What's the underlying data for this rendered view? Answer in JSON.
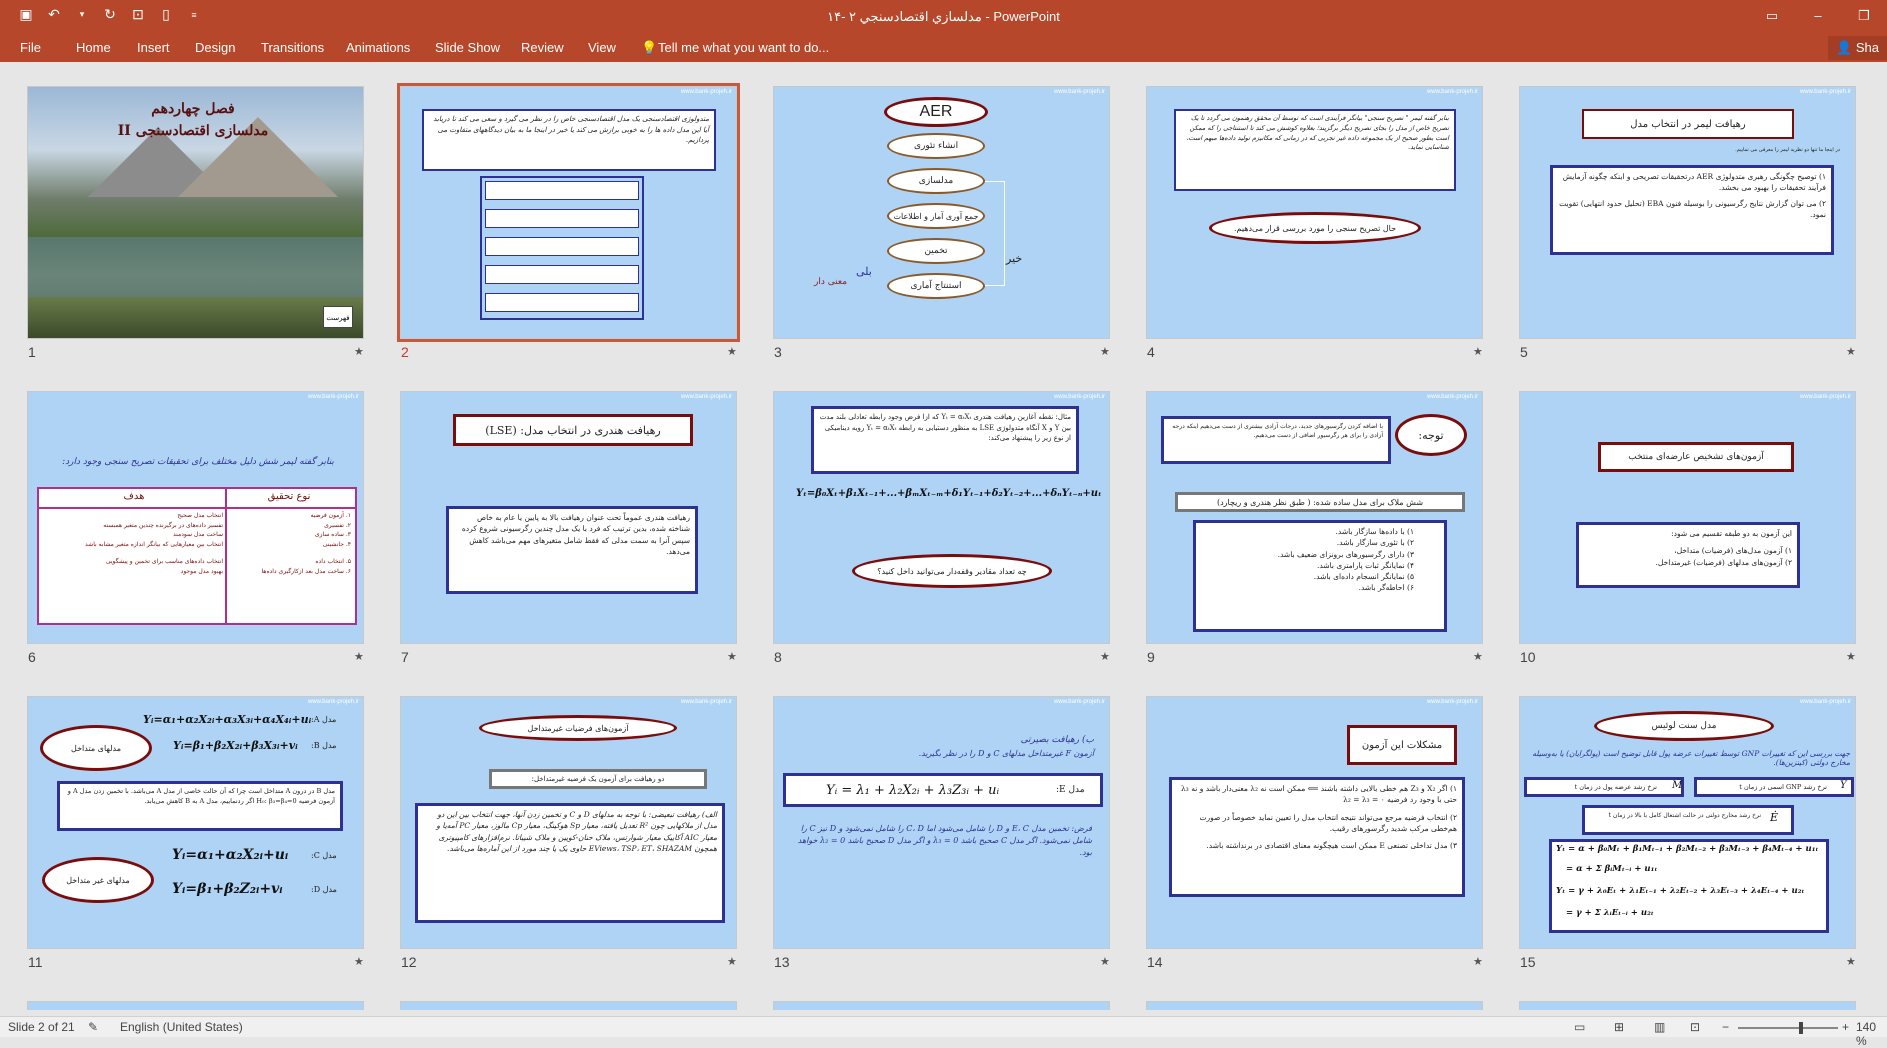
{
  "window": {
    "title": "۱۴- مدلسازي اقتصادسنجي ۲ - PowerPoint",
    "share": "Sha"
  },
  "qat_icons": [
    "save-icon",
    "undo-icon",
    "dropdown-icon",
    "redo-icon",
    "present-icon",
    "new-icon",
    "customize-icon"
  ],
  "ribbon": {
    "tabs": [
      "File",
      "Home",
      "Insert",
      "Design",
      "Transitions",
      "Animations",
      "Slide Show",
      "Review",
      "View"
    ],
    "tell_me": "Tell me what you want to do..."
  },
  "watermark": "www.bank-projeh.ir",
  "slides": {
    "s1": {
      "num": "1",
      "title": "فصل چهاردهم",
      "subtitle": "مدلسازی اقتصادسنجی II",
      "badge": "فهرست"
    },
    "s2": {
      "num": "2",
      "text": "متدولوژی اقتصادسنجی یک مدل اقتصادسنجی خاص را در نظر می گیرد و سعی می کند تا دریابد آیا این مدل داده ها را به خوبی برازش می کند یا خیر در اینجا ما به بیان دیدگاههای متفاوت می پردازیم."
    },
    "s3": {
      "num": "3",
      "aer": "AER",
      "steps": [
        "انشاء تئوری",
        "مدلسازی",
        "جمع آوری آمار و اطلاعات",
        "تخمین",
        "استنتاج آماری"
      ],
      "yes": "بلی",
      "no": "خیر",
      "meaningful": "معنی دار"
    },
    "s4": {
      "num": "4",
      "text": "بنابر گفته لیمر \" تصریح سنجی\" بیانگر فرآیندی است که توسط آن محقق رهنمون می گردد تا یک تصریح خاص از مدل را بجای تصریح دیگر برگزیند؛ بعلاوه کوشش می کند تا استنتاجی را که ممکن است بطور صحیح از یک مجموعه داده غیر تجربی که در زمانی که مکانیزم تولید داده‌ها مبهم است، شناسایی نماید.",
      "oval": "حال تصریح سنجی را مورد بررسی قرار می‌دهیم."
    },
    "s5": {
      "num": "5",
      "title": "رهیافت لیمر در انتخاب مدل",
      "note": "در اینجا ما تنها دو نظریه لیمر را معرفی می نماییم.",
      "p1": "۱) توصیح چگونگی رهبری متدولوژی AER درتحقیقات تصریحی و اینکه چگونه آزمایش فرآیند تحقیقات را بهبود می بخشد.",
      "p2": "۲) می توان گزارش نتایج رگرسیونی را بوسیله فنون EBA (تحلیل حدود انتهایی) تقویت نمود."
    },
    "s6": {
      "num": "6",
      "intro": "بنابر گفته لیمر شش دلیل مختلف برای تحقیقات تصریح سنجی وجود دارد:",
      "col1": "نوع تحقیق",
      "col2": "هدف",
      "rows1": [
        "۱. آزمون فرضیه",
        "۲. تفسیری",
        "۳. ساده سازی",
        "۴. جانشینی",
        "۵. انتخاب داده",
        "۶. ساخت مدل بعد ازکارگیری داده‌ها"
      ],
      "rows2": [
        "انتخاب مدل صحیح",
        "تفسیر داده‌های در برگیرنده چندین متغیر همبسته",
        "ساخت مدل سودمند",
        "انتخاب بین معیارهایی که بیانگر اندازه متغیر مشابه باشد",
        "انتخاب داده‌های مناسب برای تخمین و پیشگویی",
        "بهبود مدل موجود"
      ]
    },
    "s7": {
      "num": "7",
      "title": "رهیافت هندری در انتخاب مدل: (LSE)",
      "text": "رهیافت هندری عموماً تحت عنوان رهیافت بالا به پایین یا عام به خاص شناخته شده، بدین ترتیب که فرد با یک مدل چندین رگرسیونی شروع کرده سپس آنرا به سمت مدلی که فقط شامل متغیرهای مهم می‌باشد کاهش می‌دهد."
    },
    "s8": {
      "num": "8",
      "text": "مثال: نقطه آغازین رهیافت هندری Yₜ = αₜXₜ که ازا فرض وجود رابطه تعادلی بلند مدت بین Y و X آنگاه متدولوژی LSE به منظور دستیابی به رابطه Yₜ = αₜXₜ رویه دینامیکی از نوع زیر را پیشنهاد می‌کند:",
      "eq": "Yₜ=β₀Xₜ+β₁Xₜ₋₁+...+βₘXₜ₋ₘ+δ₁Yₜ₋₁+δ₂Yₜ₋₂+...+δₙYₜ₋ₙ+uₜ",
      "oval": "چه تعداد مقادیر وقفه‌دار می‌توانید داخل کنید؟"
    },
    "s9": {
      "num": "9",
      "title": "توجه:",
      "text": "با اضافه کردن رگرسیورهای جدید، درجات آزادی بیشتری از دست می‌دهیم اینکه درجه آزادی را برای هر رگرسیور اضافی از دست می‌دهیم.",
      "heading": "شش ملاک برای مدل ساده شده: ( طبق نظر هندری و ریچارد)",
      "items": [
        "۱) با داده‌ها سازگار باشد.",
        "۲) با تئوری سازگار باشد.",
        "۳) دارای رگرسیورهای برونزای ضعیف باشد.",
        "۴) نمایانگر ثبات پارامتری باشد.",
        "۵) نمایانگر انسجام داده‌ای باشد.",
        "۶) احاطه‌گر باشد."
      ]
    },
    "s10": {
      "num": "10",
      "title": "آزمون‌های تشخیص عارضه‌ای منتخب",
      "intro": "این آزمون به دو طبقه تقسیم می شود:",
      "i1": "۱) آزمون مدل‌های (فرضیات) متداخل،",
      "i2": "۲) آزمون‌های مدلهای (فرضیات) غیرمتداخل."
    },
    "s11": {
      "num": "11",
      "eqA": "Yᵢ=α₁+α₂X₂ᵢ+α₃X₃ᵢ+α₄X₄ᵢ+uᵢ",
      "eqB": "Yᵢ=β₁+β₂X₂ᵢ+β₃X₃ᵢ+vᵢ",
      "labelA": "مدل A:",
      "labelB": "مدل B:",
      "oval1": "مدلهای متداخل",
      "text": "مدل B در درون A متداخل است چرا که آن حالت خاصی از مدل A می‌باشد. با تخمین زدن مدل A و آزمون فرضیه H₀: β₃=β₄=0 اگر ردنماییم، مدل A به B کاهش می‌یابد.",
      "eqC": "Yᵢ=α₁+α₂X₂ᵢ+uᵢ",
      "eqD": "Yᵢ=β₁+β₂Z₂ᵢ+vᵢ",
      "labelC": "مدل C:",
      "labelD": "مدل D:",
      "oval2": "مدلهای غیر متداخل"
    },
    "s12": {
      "num": "12",
      "title": "آزمون‌های فرضیات غیرمتداخل",
      "sub": "دو رهیافت برای آزمون یک فرضیه غیرمتداخل:",
      "text": "الف) رهیافت تبعیضی: با توجه به مدلهای D و C و تخمین زدن آنها، جهت انتخاب بین این دو مدل از ملاکهایی چون R² تعدیل یافته، معیار Sp هوکینگ، معیار Cp مالوز، معیار PC آمه‌یا و معیار AIC آکاییک معیار شوارتس، ملاک حنان-کویین و ملاک شیباتا. نرم‌افزارهای کامپیوتری همچون EViews، TSP، ET، SHAZAM حاوی یک یا چند مورد از این آماره‌ها می‌باشد."
    },
    "s13": {
      "num": "13",
      "title": "ب) رهیافت بصیرتی",
      "sub": "آزمون F غیرمتداخل مدلهای C و D را در نظر بگیرید.",
      "eq": "Yᵢ = λ₁ + λ₂X₂ᵢ + λ₃Z₃ᵢ + uᵢ",
      "label": "مدل E:",
      "text": "فرض: تخمین مدل E، C و D را شامل می‌شود اما C، D را شامل نمی‌شود و D نیز C را شامل نمی‌شود. اگر مدل C صحیح باشد λ₃ = 0 و اگر مدل D صحیح باشد λ₂ = 0 خواهد بود."
    },
    "s14": {
      "num": "14",
      "title": "مشکلات این آزمون",
      "p1": "۱) اگر X₂ و Z₃ هم خطی بالایی داشته باشند ⟸ ممکن است نه λ₂ معنی‌دار باشد و نه λ₃ حتی با وجود رد فرضیه λ₂ = λ₃ = ۰",
      "p2": "۲) انتخاب فرضیه مرجع می‌تواند نتیجه انتخاب مدل را تعیین نماید خصوصاً در صورت هم‌خطی مرکب شدید رگرسورهای رقیب.",
      "p3": "۳) مدل تداخلی تصنعی E ممکن است هیچگونه معنای اقتصادی در برنداشته باشد."
    },
    "s15": {
      "num": "15",
      "title": "مدل سنت لوئیس",
      "text": "جهت بررسی این که تغییرات GNP توسط تغییرات عرضه پول قابل توضیح است (پولگرایان) یا به‌وسیله مخارج دولتی (کینزین‌ها).",
      "l1": "نرخ رشد GNP اسمی در زمان t",
      "l2": "نرخ رشد عرضه پول در زمان t",
      "l3": "نرخ رشد مخارج دولتی در حالت اشتغال کامل یا بالا در زمان t",
      "e1": "Yₜ = α + β₀Mₜ + β₁Mₜ₋₁ + β₂Mₜ₋₂ + β₃Mₜ₋₃ + β₄Mₜ₋₄ + u₁ₜ",
      "e2": "= α + Σ βᵢMₜ₋ᵢ + u₁ₜ",
      "e3": "Yₜ = γ + λ₀Eₜ + λ₁Eₜ₋₁ + λ₂Eₜ₋₂ + λ₃Eₜ₋₃ + λ₄Eₜ₋₄ + u₂ₜ",
      "e4": "= γ + Σ λᵢEₜ₋ᵢ + u₂ₜ",
      "sym1": "Ẏ",
      "sym2": "Ṁ",
      "sym3": "Ė"
    }
  },
  "status": {
    "slide": "Slide 2 of 21",
    "lang": "English (United States)",
    "zoom": "140 %"
  }
}
